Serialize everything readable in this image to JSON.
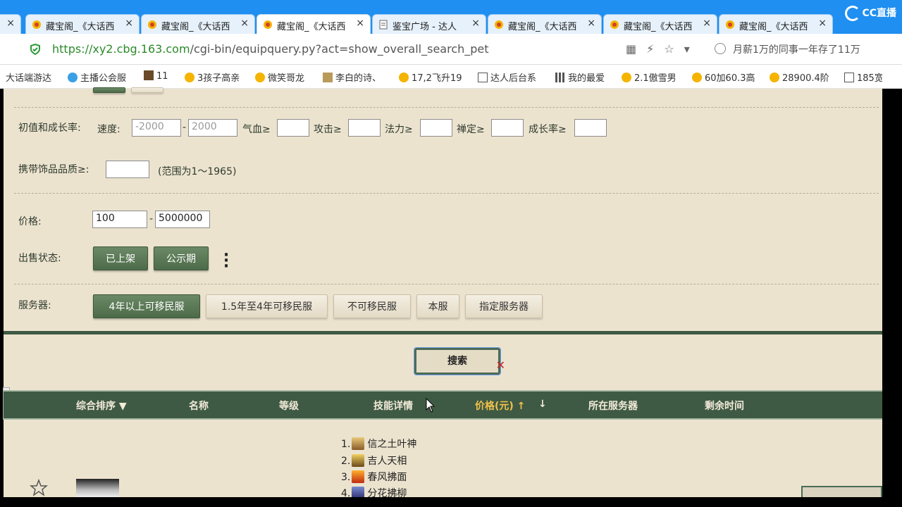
{
  "browser": {
    "tabs": [
      {
        "label": "藏宝阁_《大话西",
        "active": false
      },
      {
        "label": "藏宝阁_《大话西",
        "active": false
      },
      {
        "label": "藏宝阁_《大话西",
        "active": true
      },
      {
        "label": "鉴宝广场 - 达人",
        "active": false
      },
      {
        "label": "藏宝阁_《大话西",
        "active": false
      },
      {
        "label": "藏宝阁_《大话西",
        "active": false
      },
      {
        "label": "藏宝阁_《大话西",
        "active": false
      }
    ],
    "first_tab_close": "×",
    "close_glyph": "×",
    "stream_logo": "CC直播",
    "url": {
      "scheme": "https://",
      "host": "xy2.cbg.163.com",
      "path": "/cgi-bin/equipquery.py?act=show_overall_search_pet"
    },
    "address_news": "月薪1万的同事一年存了11万",
    "bookmarks": [
      "大话端游达",
      "主播公会服",
      "11",
      "3孩子高亲",
      "微笑哥龙",
      "李白的诗、",
      "17,2飞升19",
      "达人后台系",
      "我的最爱",
      "2.1傲雪男",
      "60加60.3高",
      "28900.4阶",
      "185宽"
    ]
  },
  "filters": {
    "initial_growth_label": "初值和成长率:",
    "speed_label": "速度:",
    "speed_min_placeholder": "-2000",
    "speed_max_placeholder": "2000",
    "hp_label": "气血≥",
    "attack_label": "攻击≥",
    "mana_label": "法力≥",
    "zen_label": "禅定≥",
    "growth_label": "成长率≥",
    "accessory_label": "携带饰品品质≥:",
    "accessory_range": "(范围为1～1965)",
    "price_label": "价格:",
    "price_min": "100",
    "price_max": "5000000",
    "sale_status_label": "出售状态:",
    "sale_status_options": [
      "已上架",
      "公示期"
    ],
    "server_label": "服务器:",
    "server_options": [
      "4年以上可移民服",
      "1.5年至4年可移民服",
      "不可移民服",
      "本服",
      "指定服务器"
    ],
    "dash": "-"
  },
  "search_button_label": "搜索",
  "results": {
    "columns": [
      "综合排序 ▼",
      "名称",
      "等级",
      "技能详情",
      "价格(元) ↑",
      "↓",
      "所在服务器",
      "剩余时间"
    ],
    "skills": [
      {
        "index": "1.",
        "name": "信之土叶神"
      },
      {
        "index": "2.",
        "name": "吉人天相"
      },
      {
        "index": "3.",
        "name": "春风拂面"
      },
      {
        "index": "4.",
        "name": "分花拂柳"
      }
    ]
  },
  "colors": {
    "page_bg": "#ece3cf",
    "primary_green": "#4d6b49",
    "header_green": "#3f5a44",
    "highlight": "#f1c24a",
    "browser_blue": "#1f8ff1"
  }
}
